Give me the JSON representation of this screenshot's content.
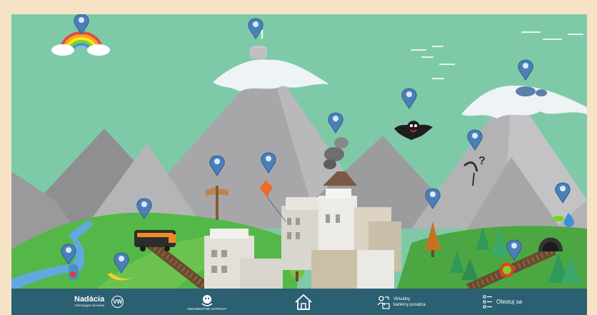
{
  "colors": {
    "sky": "#7ecaa8",
    "footer": "#2b5f72",
    "pin": "#4a7fb8",
    "mountain": "#a9a9ab",
    "snow": "#eef3f6",
    "grass": "#54b848"
  },
  "map_pins": [
    {
      "name": "pin-rainbow",
      "icon": "rainbow-cloud-icon"
    },
    {
      "name": "pin-cooking-pot",
      "icon": "cooking-pot-icon"
    },
    {
      "name": "pin-footprints",
      "icon": "footprints-icon"
    },
    {
      "name": "pin-bat",
      "icon": "bat-icon"
    },
    {
      "name": "pin-volcano",
      "icon": "volcano-icon"
    },
    {
      "name": "pin-question-bird",
      "icon": "bird-question-icon"
    },
    {
      "name": "pin-signpost",
      "icon": "signpost-icon"
    },
    {
      "name": "pin-kite",
      "icon": "kite-icon"
    },
    {
      "name": "pin-tree",
      "icon": "tree-icon"
    },
    {
      "name": "pin-water-drop",
      "icon": "water-drop-icon"
    },
    {
      "name": "pin-train",
      "icon": "train-icon"
    },
    {
      "name": "pin-river",
      "icon": "river-icon"
    },
    {
      "name": "pin-banana",
      "icon": "banana-icon"
    },
    {
      "name": "pin-tunnel",
      "icon": "tunnel-icon"
    }
  ],
  "footer": {
    "brand": {
      "name": "Nadácia",
      "subtitle": "Volkswagen Slovakia",
      "logo_icon": "vw-logo-icon"
    },
    "game_logo": {
      "text": "VEDOMOSTNÉ OSTROVY",
      "icon": "monkey-logo-icon"
    },
    "home": {
      "icon": "home-icon"
    },
    "advisor": {
      "line1": "Virtuálny",
      "line2": "kariérny poradca",
      "icon": "advisor-icon"
    },
    "test": {
      "label": "Otestuj sa",
      "icon": "checklist-icon"
    }
  }
}
